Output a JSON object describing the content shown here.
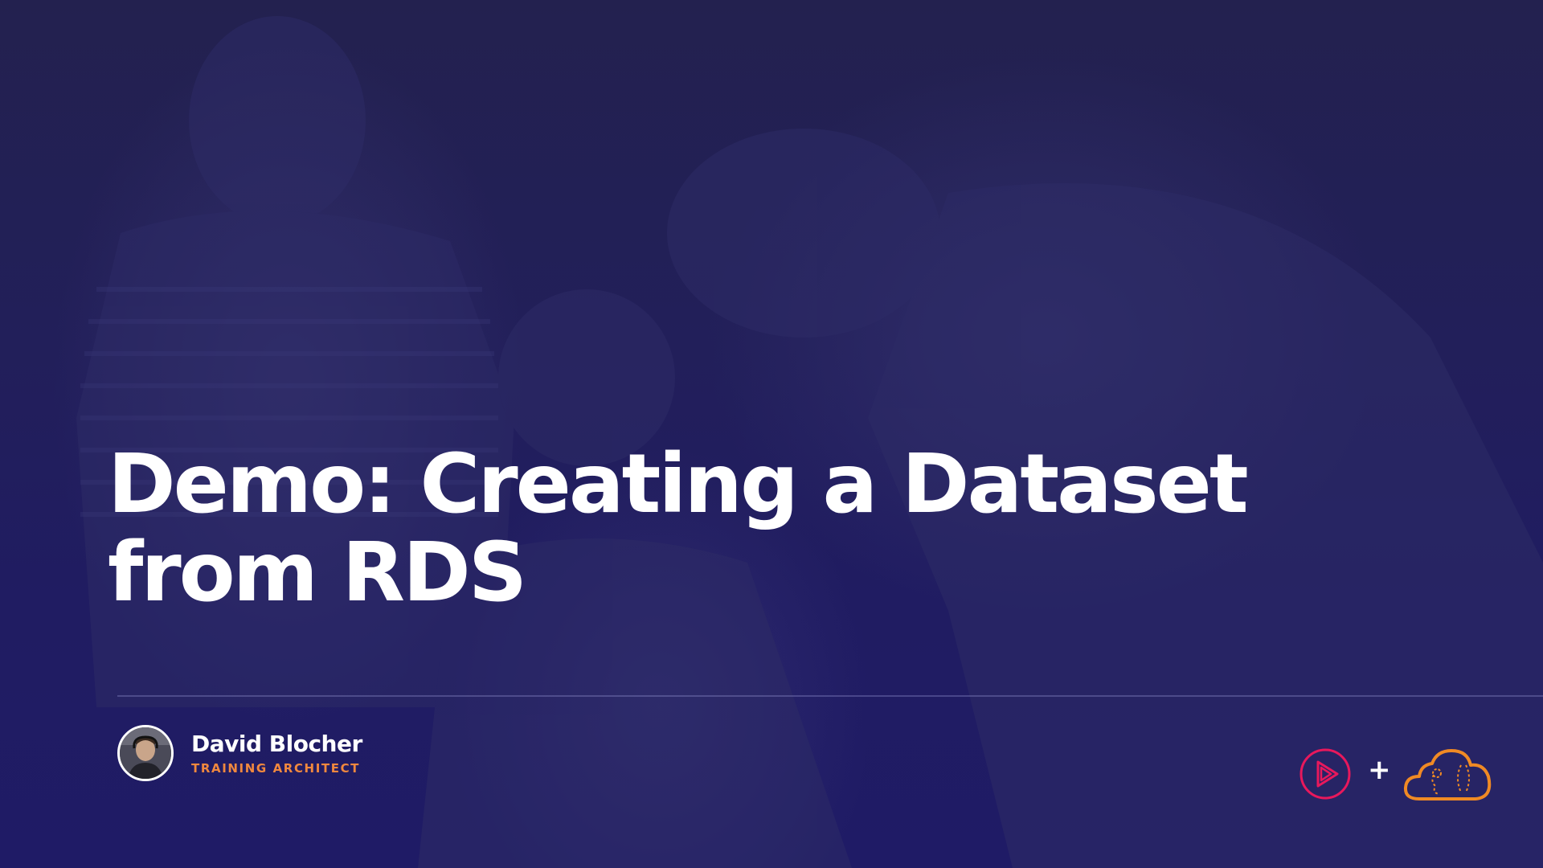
{
  "slide": {
    "title_lines": [
      "Demo: Creating a Dataset",
      "from RDS"
    ],
    "presenter": {
      "name": "David Blocher",
      "role": "TRAINING ARCHITECT"
    },
    "logos": {
      "left_icon": "pluralsight-play-icon",
      "separator": "+",
      "right_icon": "acloudguru-cloud-icon"
    },
    "colors": {
      "background": "#201c5e",
      "title": "#ffffff",
      "role_accent": "#f0883e",
      "pluralsight_accent": "#e8185c",
      "acg_accent": "#f08a24"
    }
  }
}
